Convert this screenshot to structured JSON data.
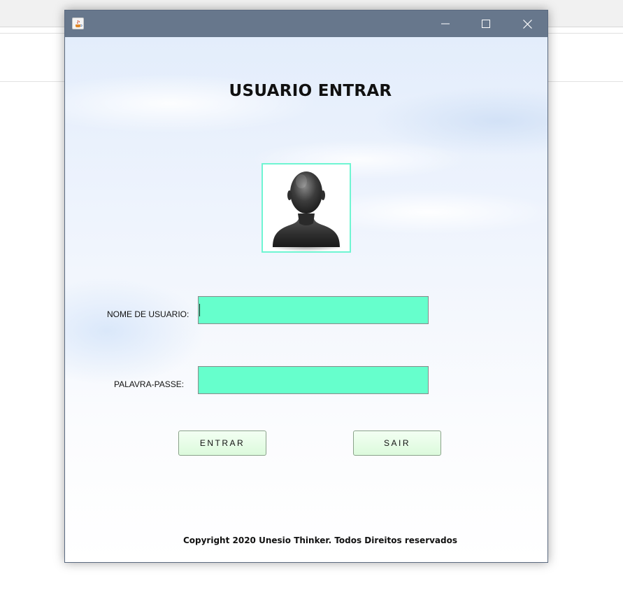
{
  "window": {
    "title": "",
    "controls": {
      "minimize_icon": "minimize-icon",
      "maximize_icon": "maximize-icon",
      "close_icon": "close-icon"
    }
  },
  "form": {
    "heading": "USUARIO ENTRAR",
    "avatar_icon": "user-silhouette-icon",
    "username_label": "NOME DE USUARIO:",
    "username_value": "",
    "password_label": "PALAVRA-PASSE:",
    "password_value": "",
    "login_button": "ENTRAR",
    "exit_button": "SAIR"
  },
  "footer": {
    "copyright": "Copyright 2020 Unesio Thinker. Todos Direitos reservados"
  },
  "colors": {
    "titlebar": "#67778c",
    "field_bg": "#66ffcc",
    "avatar_border": "#6ff5d2",
    "button_bg": "#dcfadc"
  }
}
